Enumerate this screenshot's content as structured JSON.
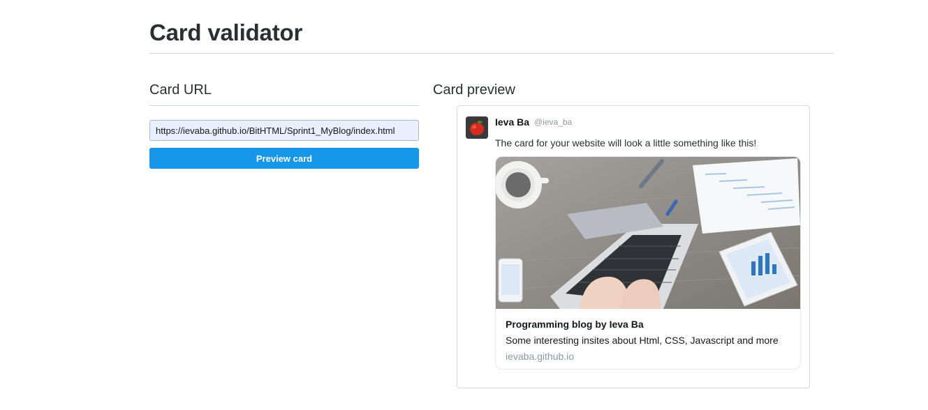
{
  "page": {
    "title": "Card validator"
  },
  "card_url_section": {
    "heading": "Card URL",
    "url_value": "https://ievaba.github.io/BitHTML/Sprint1_MyBlog/index.html",
    "button_label": "Preview card"
  },
  "card_preview_section": {
    "heading": "Card preview",
    "tweet": {
      "author_name": "Ieva Ba",
      "author_handle": "@ieva_ba",
      "text": "The card for your website will look a little something like this!",
      "card": {
        "title": "Programming blog by Ieva Ba",
        "description": "Some interesting insites about Html, CSS, Javascript and more",
        "domain": "ievaba.github.io"
      }
    }
  },
  "colors": {
    "accent": "#1596e8",
    "rule": "#ccd6dd",
    "muted": "#8899a6"
  }
}
